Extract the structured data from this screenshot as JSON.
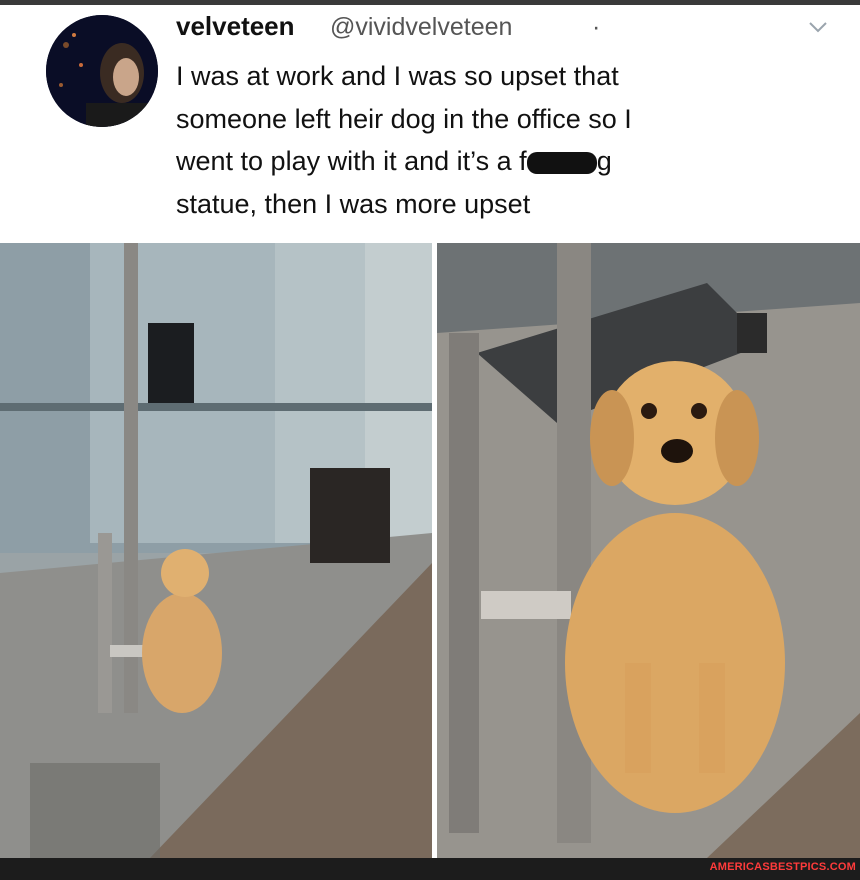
{
  "tweet": {
    "display_name": "velveteen",
    "handle": "@vividvelveteen",
    "separator": "·",
    "text_line1": "I was at work and I was so upset that",
    "text_line2": "someone left heir dog in the office so I",
    "text_line3_prefix": "went to play with it and it’s a f",
    "text_line3_suffix": "g",
    "text_line4": "statue, then I was more upset",
    "menu_icon": "chevron-down-icon"
  },
  "photos": {
    "left_description_icon": "photo",
    "right_description_icon": "photo"
  },
  "footer": {
    "watermark": "AMERICASBESTPICS.COM",
    "watermark_color": "#ff3b3b"
  }
}
